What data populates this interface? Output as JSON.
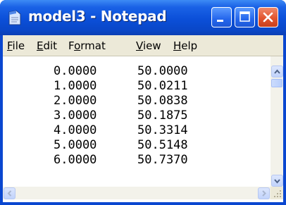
{
  "window": {
    "title": "model3 - Notepad",
    "app_icon": "notepad-icon"
  },
  "title_buttons": [
    {
      "name": "minimize-button",
      "icon": "minimize-icon"
    },
    {
      "name": "maximize-button",
      "icon": "maximize-icon"
    },
    {
      "name": "close-button",
      "icon": "close-icon"
    }
  ],
  "menubar": {
    "file": {
      "accel": "F",
      "rest": "ile"
    },
    "edit": {
      "accel": "E",
      "rest": "dit"
    },
    "format_pre": "F",
    "format_accel": "o",
    "format_post": "rmat",
    "view": {
      "accel": "V",
      "rest": "iew"
    },
    "help": {
      "accel": "H",
      "rest": "elp"
    }
  },
  "document": {
    "rows": [
      {
        "x": "0.0000",
        "y": "50.0000"
      },
      {
        "x": "1.0000",
        "y": "50.0211"
      },
      {
        "x": "2.0000",
        "y": "50.0838"
      },
      {
        "x": "3.0000",
        "y": "50.1875"
      },
      {
        "x": "4.0000",
        "y": "50.3314"
      },
      {
        "x": "5.0000",
        "y": "50.5148"
      },
      {
        "x": "6.0000",
        "y": "50.7370"
      }
    ]
  },
  "colors": {
    "titlebar": "#0b4fd8",
    "menubar": "#ece9d8",
    "close_button": "#e2552f"
  }
}
